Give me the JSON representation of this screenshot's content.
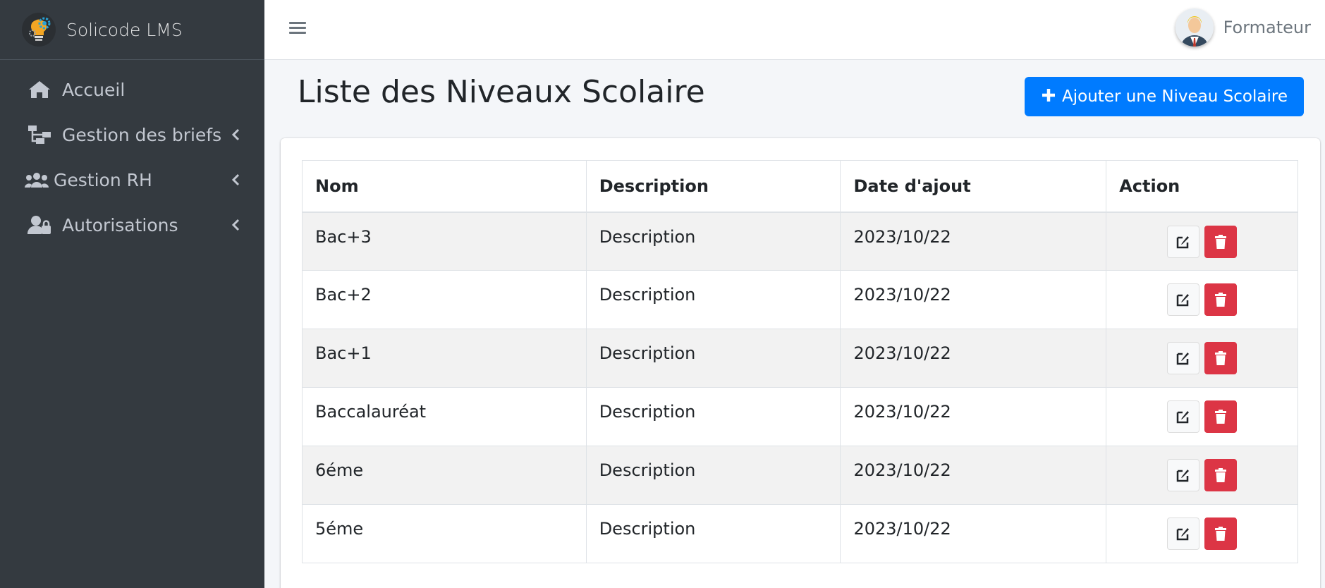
{
  "brand": {
    "name": "Solicode LMS",
    "logo_icon": "lightbulb-gear-logo"
  },
  "sidebar": {
    "items": [
      {
        "label": "Accueil",
        "icon": "home-icon",
        "has_submenu": false
      },
      {
        "label": "Gestion des briefs",
        "icon": "sitemap-icon",
        "has_submenu": true
      },
      {
        "label": "Gestion RH",
        "icon": "users-icon",
        "has_submenu": true
      },
      {
        "label": "Autorisations",
        "icon": "user-lock-icon",
        "has_submenu": true
      }
    ]
  },
  "topbar": {
    "menu_icon": "hamburger-icon",
    "user_name": "Formateur"
  },
  "page": {
    "title": "Liste des Niveaux Scolaire",
    "add_button_label": "Ajouter une Niveau Scolaire"
  },
  "table": {
    "columns": [
      "Nom",
      "Description",
      "Date d'ajout",
      "Action"
    ],
    "rows": [
      {
        "nom": "Bac+3",
        "description": "Description",
        "date": "2023/10/22"
      },
      {
        "nom": "Bac+2",
        "description": "Description",
        "date": "2023/10/22"
      },
      {
        "nom": "Bac+1",
        "description": "Description",
        "date": "2023/10/22"
      },
      {
        "nom": "Baccalauréat",
        "description": "Description",
        "date": "2023/10/22"
      },
      {
        "nom": "6éme",
        "description": "Description",
        "date": "2023/10/22"
      },
      {
        "nom": "5éme",
        "description": "Description",
        "date": "2023/10/22"
      }
    ]
  },
  "colors": {
    "sidebar_bg": "#343a40",
    "primary": "#007bff",
    "danger": "#dc3545",
    "content_bg": "#f4f6f9"
  }
}
